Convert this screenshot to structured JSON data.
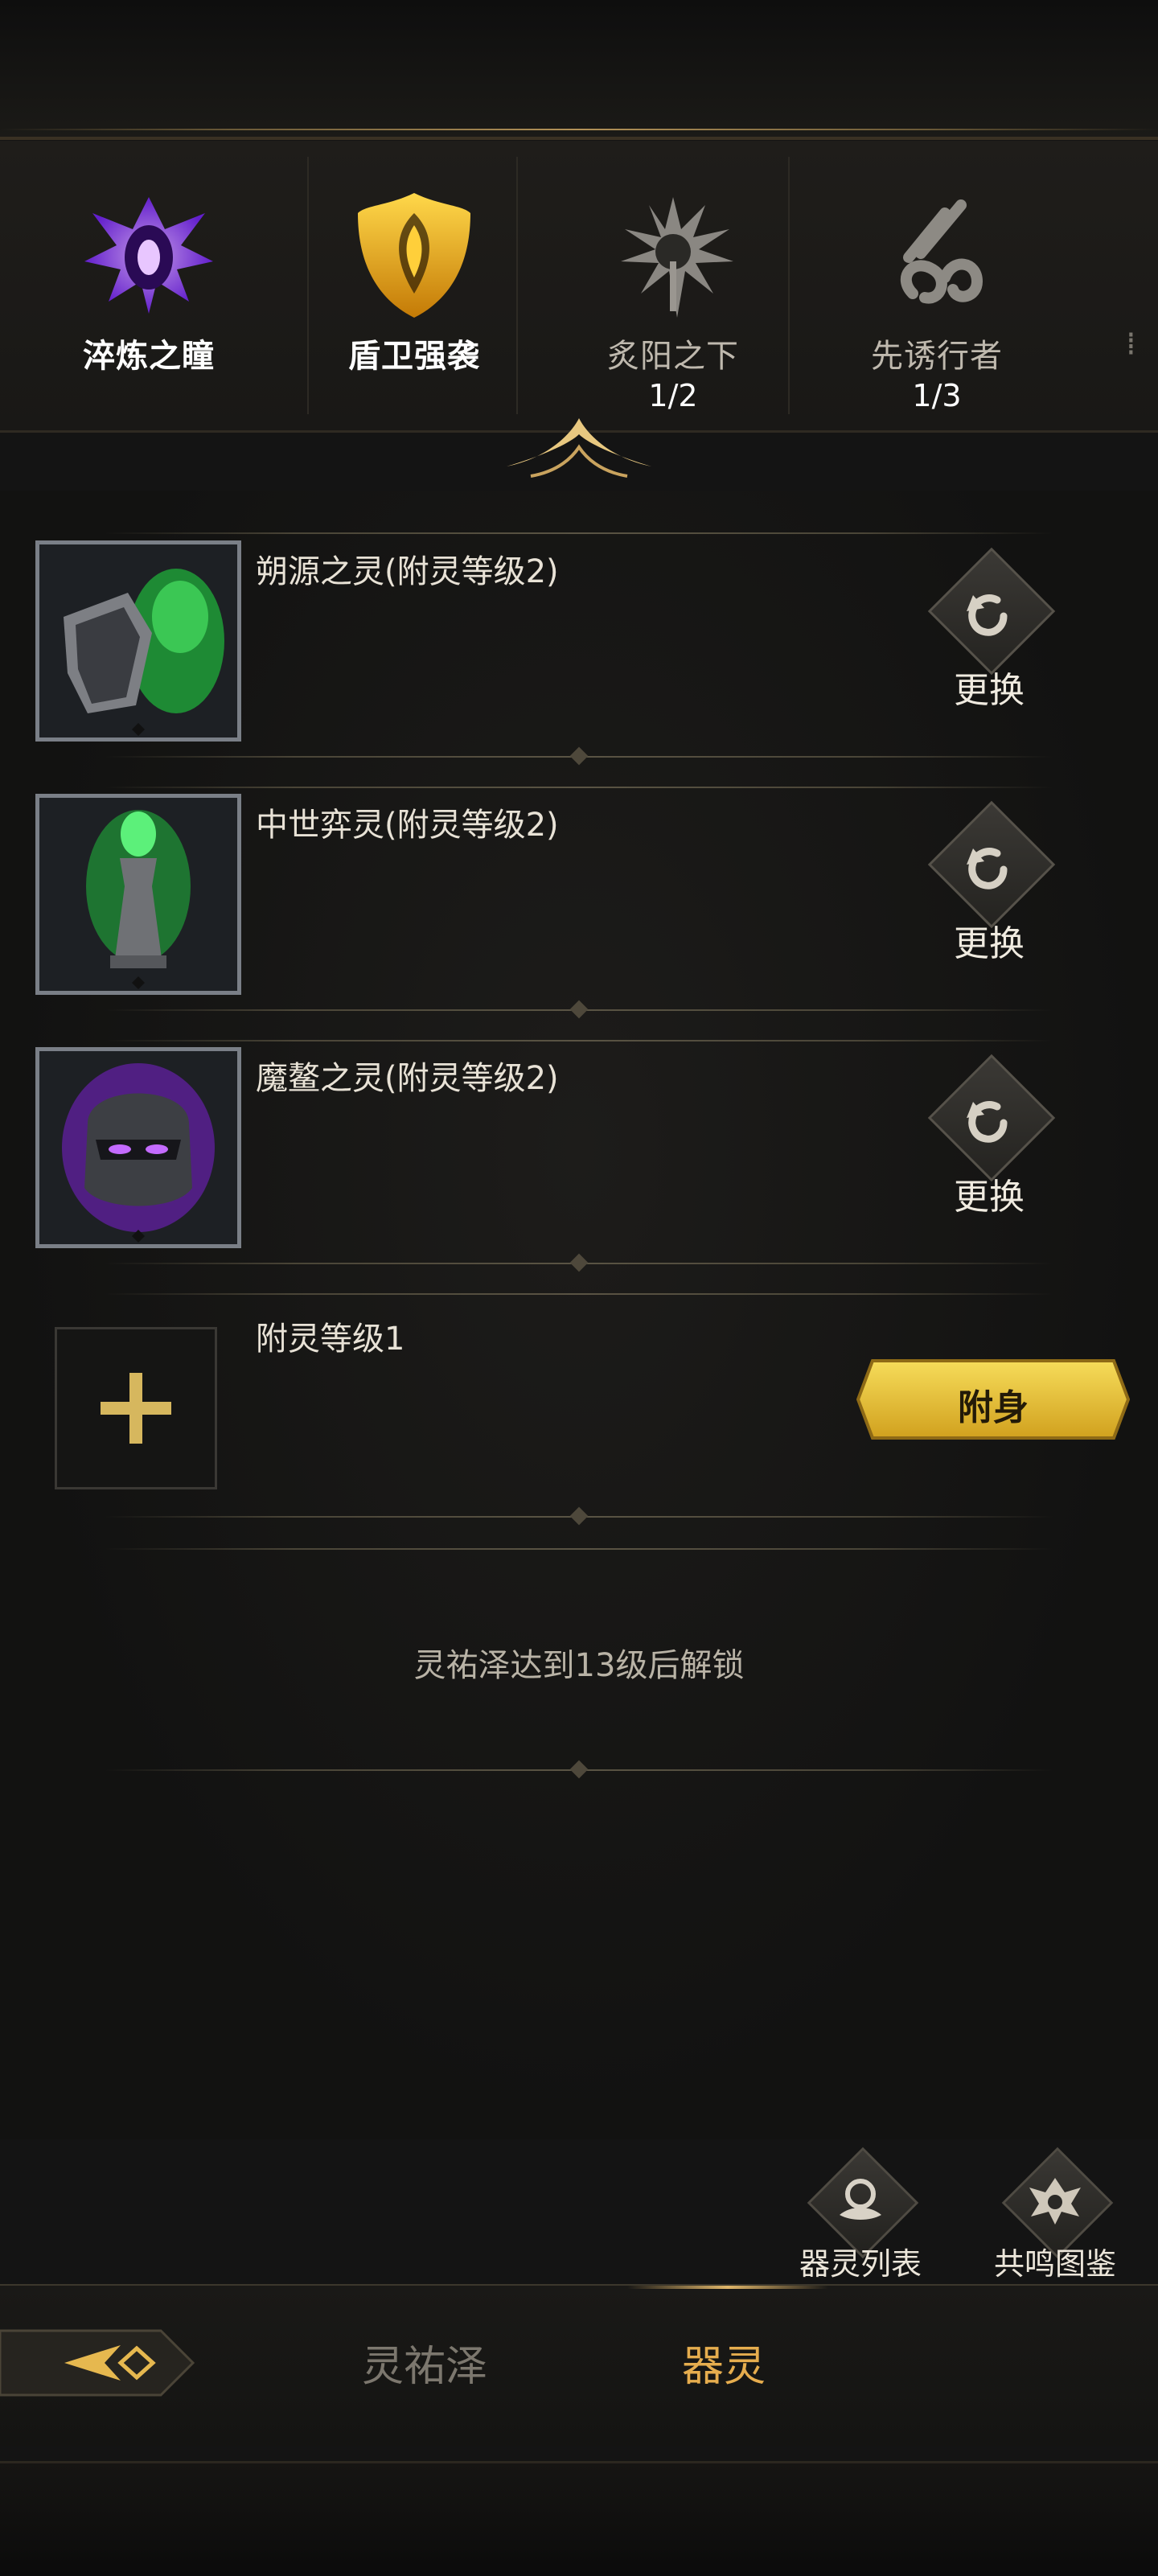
{
  "theme": {
    "accent_gold": "#e6ad4e",
    "active_tab_icon_purple": "#8a3cff",
    "active_tab_icon_gold": "#f0b410",
    "button_gold": "#e8c23a"
  },
  "tabs": [
    {
      "label": "淬炼之瞳",
      "progress": "",
      "state": "active",
      "icon": "purple-eye-emblem-icon"
    },
    {
      "label": "盾卫强袭",
      "progress": "",
      "state": "active",
      "icon": "golden-shield-emblem-icon"
    },
    {
      "label": "炙阳之下",
      "progress": "1/2",
      "state": "inactive",
      "icon": "sun-tree-emblem-icon"
    },
    {
      "label": "先诱行者",
      "progress": "1/3",
      "state": "inactive",
      "icon": "swirl-claw-emblem-icon"
    }
  ],
  "slots": [
    {
      "title": "朔源之灵(附灵等级2)",
      "action": "更换",
      "icon": "green-armor-spirit-icon"
    },
    {
      "title": "中世弈灵(附灵等级2)",
      "action": "更换",
      "icon": "green-chess-spirit-icon"
    },
    {
      "title": "魔鳌之灵(附灵等级2)",
      "action": "更换",
      "icon": "purple-helmet-spirit-icon"
    }
  ],
  "empty_slot": {
    "title": "附灵等级1",
    "action": "附身",
    "icon": "plus-icon"
  },
  "locked_slot": {
    "text": "灵祐泽达到13级后解锁"
  },
  "tools": {
    "spirit_list": "器灵列表",
    "resonance_codex": "共鸣图鉴"
  },
  "nav": {
    "tab1": "灵祐泽",
    "tab2": "器灵",
    "active": "器灵"
  }
}
